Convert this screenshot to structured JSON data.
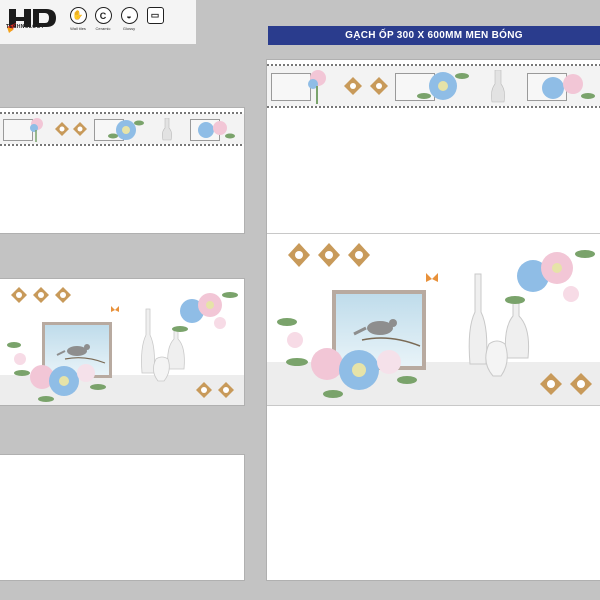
{
  "brand": {
    "logo_text": "HD",
    "logo_subtext": "TECHNOLOGY",
    "features": [
      {
        "icon": "wall-tiles-icon",
        "glyph": "✋",
        "label": "Wall tiles"
      },
      {
        "icon": "ceramic-icon",
        "glyph": "C",
        "label": "Ceramic"
      },
      {
        "icon": "glossy-icon",
        "glyph": "◒",
        "label": "Glossy"
      },
      {
        "icon": "size-icon",
        "glyph": "▭",
        "label": ""
      }
    ]
  },
  "banner": {
    "title": "GẠCH ỐP 300 X 600MM MEN BÓNG"
  },
  "colors": {
    "banner_bg": "#2a3c8d",
    "page_bg": "#c3c3c3",
    "tile_bg": "#ffffff",
    "flower_blue": "#8fbde6",
    "flower_pink": "#f2c6d6",
    "leaf_green": "#7aa36b",
    "ornament_gold": "#c89a5a"
  }
}
